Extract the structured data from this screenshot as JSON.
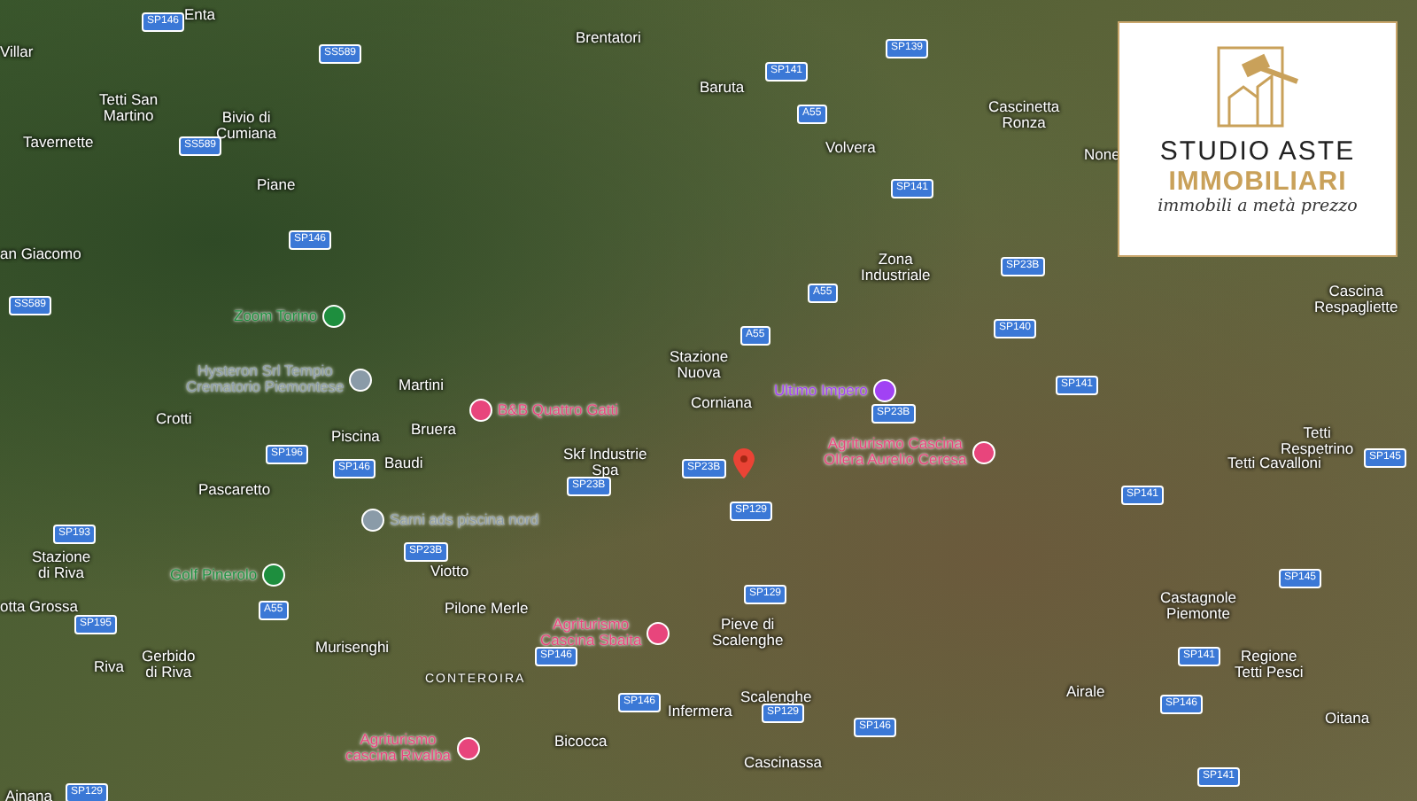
{
  "map": {
    "places": [
      {
        "text": "Enta"
      },
      {
        "text": "Villar"
      },
      {
        "text": "Tetti San\nMartino"
      },
      {
        "text": "Bivio di\nCumiana"
      },
      {
        "text": "Tavernette"
      },
      {
        "text": "Piane"
      },
      {
        "text": "an Giacomo"
      },
      {
        "text": "Martini"
      },
      {
        "text": "Brentatori"
      },
      {
        "text": "Baruta"
      },
      {
        "text": "Volvera"
      },
      {
        "text": "Zona\nIndustriale"
      },
      {
        "text": "Stazione\nNuova"
      },
      {
        "text": "Cascinetta\nRonza"
      },
      {
        "text": "None"
      },
      {
        "text": "Cascina\nRespagliette"
      },
      {
        "text": "Crotti"
      },
      {
        "text": "Piscina"
      },
      {
        "text": "Bruera"
      },
      {
        "text": "Baudi"
      },
      {
        "text": "Pascaretto"
      },
      {
        "text": "Stazione\ndi Riva"
      },
      {
        "text": "otta Grossa"
      },
      {
        "text": "Riva"
      },
      {
        "text": "Gerbido\ndi Riva"
      },
      {
        "text": "Viotto"
      },
      {
        "text": "Pilone Merle"
      },
      {
        "text": "Murisenghi"
      },
      {
        "text": "CONTEROIRA"
      },
      {
        "text": "Corniana"
      },
      {
        "text": "Skf Industrie\nSpa"
      },
      {
        "text": "Pieve di\nScalenghe"
      },
      {
        "text": "Scalenghe"
      },
      {
        "text": "Infermera"
      },
      {
        "text": "Bicocca"
      },
      {
        "text": "Cascinassa"
      },
      {
        "text": "Ainana"
      },
      {
        "text": "Tetti\nRespetrino"
      },
      {
        "text": "Tetti Cavalloni"
      },
      {
        "text": "Castagnole\nPiemonte"
      },
      {
        "text": "Regione\nTetti Pesci"
      },
      {
        "text": "Airale"
      },
      {
        "text": "Oitana"
      }
    ],
    "pois": [
      {
        "text": "Zoom Torino",
        "color": "#1e8e3e"
      },
      {
        "text": "Hysteron Srl Tempio\nCrematorio Piemontese",
        "color": "#8a9ba8"
      },
      {
        "text": "B&B Quattro Gatti",
        "color": "#e8457c"
      },
      {
        "text": "Ultimo Impero",
        "color": "#a142f4"
      },
      {
        "text": "Sarni ads piscina nord",
        "color": "#8a9ba8"
      },
      {
        "text": "Golf Pinerolo",
        "color": "#1e8e3e"
      },
      {
        "text": "Agriturismo Cascina\nOllera Aurelio Ceresa",
        "color": "#e8457c"
      },
      {
        "text": "Agriturismo\nCascina Sbaita",
        "color": "#e8457c"
      },
      {
        "text": "Agriturismo\ncascina Rivalba",
        "color": "#e8457c"
      }
    ],
    "roads": [
      {
        "text": "SP146"
      },
      {
        "text": "SS589"
      },
      {
        "text": "SS589"
      },
      {
        "text": "SP146"
      },
      {
        "text": "SS589"
      },
      {
        "text": "SP141"
      },
      {
        "text": "A55"
      },
      {
        "text": "SP139"
      },
      {
        "text": "SP141"
      },
      {
        "text": "A55"
      },
      {
        "text": "A55"
      },
      {
        "text": "SP23B"
      },
      {
        "text": "SP140"
      },
      {
        "text": "SP141"
      },
      {
        "text": "SP196"
      },
      {
        "text": "SP146"
      },
      {
        "text": "SP193"
      },
      {
        "text": "SP195"
      },
      {
        "text": "A55"
      },
      {
        "text": "SP23B"
      },
      {
        "text": "SP129"
      },
      {
        "text": "SP23B"
      },
      {
        "text": "SP23B"
      },
      {
        "text": "SP129"
      },
      {
        "text": "SP129"
      },
      {
        "text": "SP146"
      },
      {
        "text": "SP146"
      },
      {
        "text": "SP129"
      },
      {
        "text": "SP146"
      },
      {
        "text": "SP141"
      },
      {
        "text": "SP145"
      },
      {
        "text": "SP145"
      },
      {
        "text": "SP141"
      },
      {
        "text": "SP146"
      },
      {
        "text": "SP141"
      },
      {
        "text": "SP23B"
      }
    ]
  },
  "logo": {
    "title": "STUDIO ASTE",
    "subtitle": "IMMOBILIARI",
    "tagline": "immobili a metà prezzo"
  }
}
